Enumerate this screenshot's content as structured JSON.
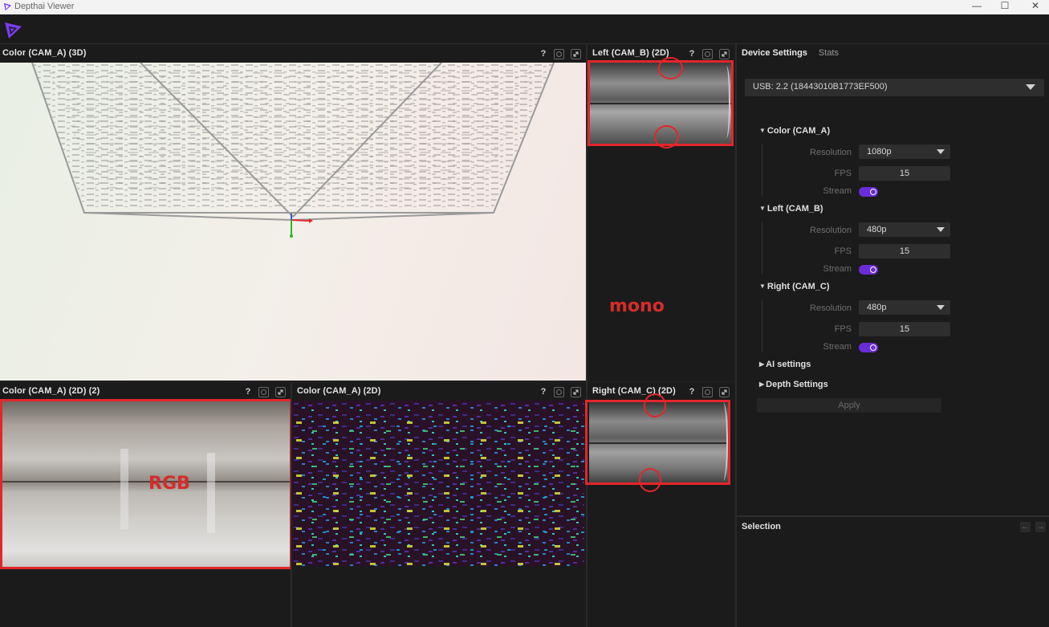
{
  "window": {
    "title": "Depthai Viewer",
    "minimize": "—",
    "maximize": "☐",
    "close": "✕"
  },
  "panels": {
    "color3d": {
      "title": "Color (CAM_A) (3D)"
    },
    "left2d": {
      "title": "Left (CAM_B) (2D)"
    },
    "color2d_2": {
      "title": "Color (CAM_A) (2D) (2)"
    },
    "color2d": {
      "title": "Color (CAM_A) (2D)"
    },
    "right2d": {
      "title": "Right (CAM_C) (2D)"
    },
    "help": "?"
  },
  "annotations": {
    "mono": "mono",
    "rgb": "RGB"
  },
  "side": {
    "tabs": [
      "Device Settings",
      "Stats"
    ],
    "device": "USB: 2.2 (18443010B1773EF500)",
    "sections": [
      {
        "title": "Color (CAM_A)",
        "resolution": "1080p",
        "fps": "15"
      },
      {
        "title": "Left (CAM_B)",
        "resolution": "480p",
        "fps": "15"
      },
      {
        "title": "Right (CAM_C)",
        "resolution": "480p",
        "fps": "15"
      }
    ],
    "labels": {
      "resolution": "Resolution",
      "fps": "FPS",
      "stream": "Stream"
    },
    "ai": "AI settings",
    "depth": "Depth Settings",
    "apply": "Apply",
    "selection": "Selection",
    "nav_back": "←",
    "nav_fwd": "→"
  },
  "colors": {
    "accent": "#6a2cd6",
    "annotation": "#e3262b"
  }
}
